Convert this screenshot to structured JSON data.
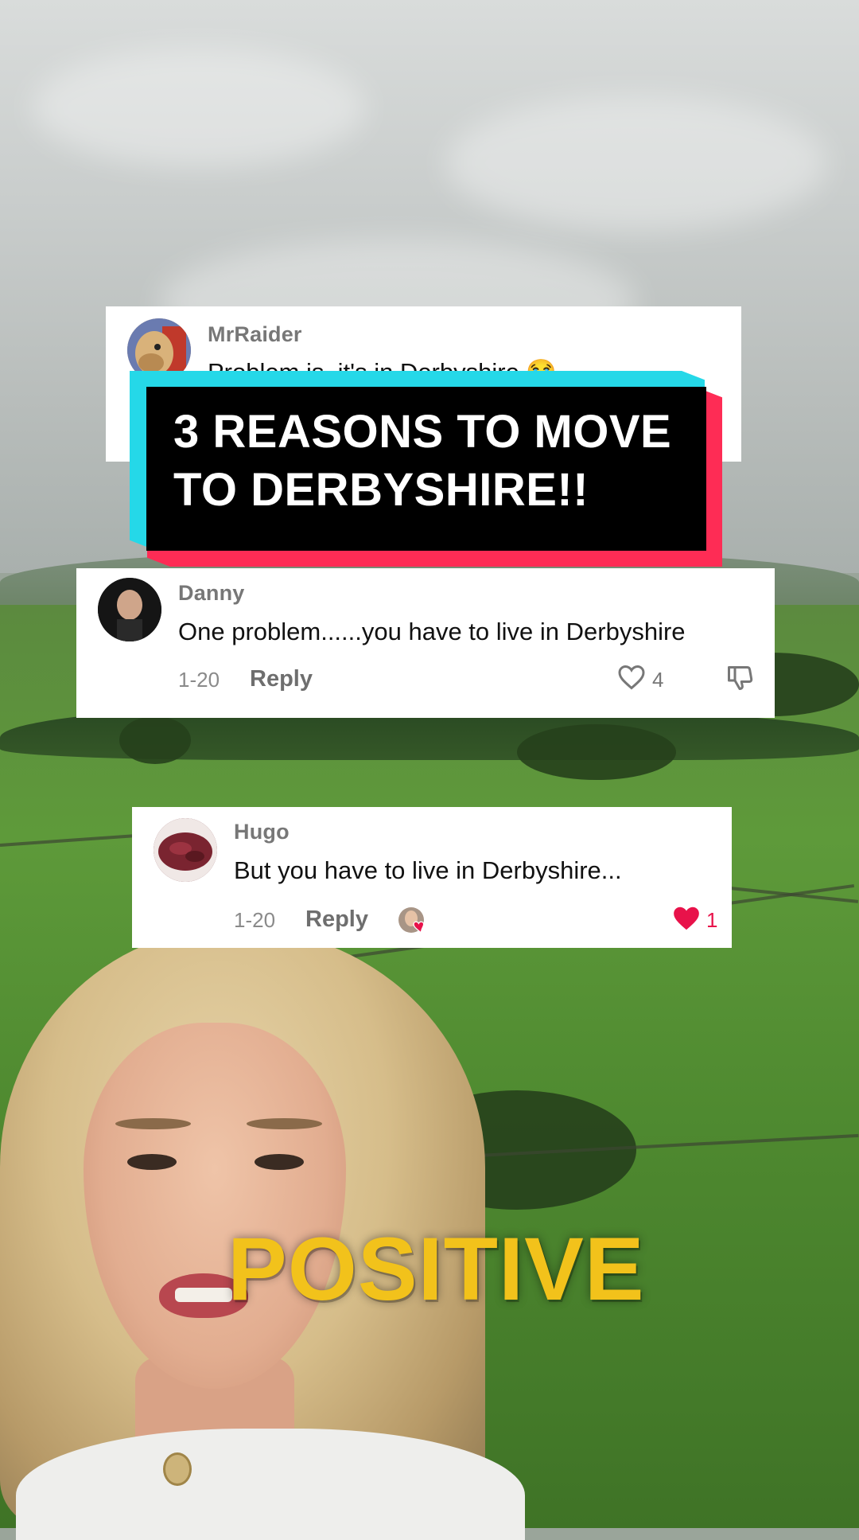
{
  "video": {
    "title_overlay": "3 REASONS TO MOVE\nTO DERBYSHIRE!!",
    "caption": "POSITIVE"
  },
  "comments": [
    {
      "username": "MrRaider",
      "text": "Problem is, it's in Derbyshire 😭",
      "avatar_icon": "horse-mascot-avatar"
    },
    {
      "username": "Danny",
      "text": "One problem......you have to live in Derbyshire",
      "date": "1-20",
      "reply_label": "Reply",
      "likes": "4",
      "liked": false
    },
    {
      "username": "Hugo",
      "text": "But you have to live in Derbyshire...",
      "date": "1-20",
      "reply_label": "Reply",
      "likes": "1",
      "liked": true,
      "creator_liked": true
    }
  ],
  "colors": {
    "tiktok_cyan": "#25d8e8",
    "tiktok_red": "#fe2c55",
    "caption_yellow": "#f2c21b",
    "liked_heart": "#e8124a"
  }
}
